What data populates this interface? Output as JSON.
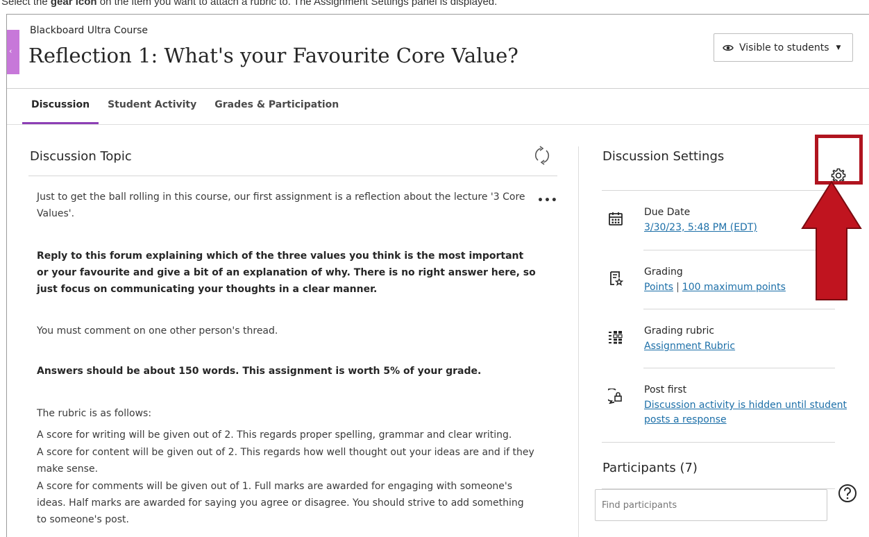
{
  "instruction": {
    "prefix": "Select the ",
    "bold": "gear icon",
    "suffix": " on the item you want to attach a rubric to. The Assignment Settings panel is displayed."
  },
  "header": {
    "course_name": "Blackboard Ultra Course",
    "title": "Reflection 1: What's your Favourite Core Value?",
    "visibility_label": "Visible to students"
  },
  "tabs": [
    {
      "label": "Discussion",
      "active": true
    },
    {
      "label": "Student Activity",
      "active": false
    },
    {
      "label": "Grades & Participation",
      "active": false
    }
  ],
  "topic": {
    "heading": "Discussion Topic",
    "paragraphs": [
      "Just to get the ball rolling in this course, our first assignment is a reflection about the lecture '3 Core Values'.",
      "Reply to this forum explaining which of the three values you think is the most important or your favourite and give a bit of an explanation of why. There is no right answer here, so just focus on communicating your thoughts in a clear manner.",
      "You must comment on one other person's thread.",
      "Answers should be about 150 words. This assignment is worth 5% of your grade.",
      "The rubric is as follows:",
      "A score for writing will be given out of 2. This regards proper spelling, grammar and clear writing.",
      "A score for content will be given out of 2. This regards how well thought out your ideas are and if they make sense.",
      "A score for comments will be given out of 1. Full marks are awarded for engaging with someone's ideas. Half marks are awarded for saying you agree or disagree. You should strive to add something to someone's post."
    ]
  },
  "settings": {
    "heading": "Discussion Settings",
    "due_date": {
      "label": "Due Date",
      "value": "3/30/23, 5:48 PM (EDT)"
    },
    "grading": {
      "label": "Grading",
      "points": "Points",
      "separator": "|",
      "max": "100 maximum points"
    },
    "rubric": {
      "label": "Grading rubric",
      "value": "Assignment Rubric"
    },
    "post_first": {
      "label": "Post first",
      "value": "Discussion activity is hidden until student posts a response"
    }
  },
  "participants": {
    "heading": "Participants (7)",
    "search_placeholder": "Find participants"
  },
  "colors": {
    "accent": "#8c3fb5",
    "highlight": "#b0141f",
    "link": "#1c6fa8",
    "side_tab": "#c778d9"
  }
}
